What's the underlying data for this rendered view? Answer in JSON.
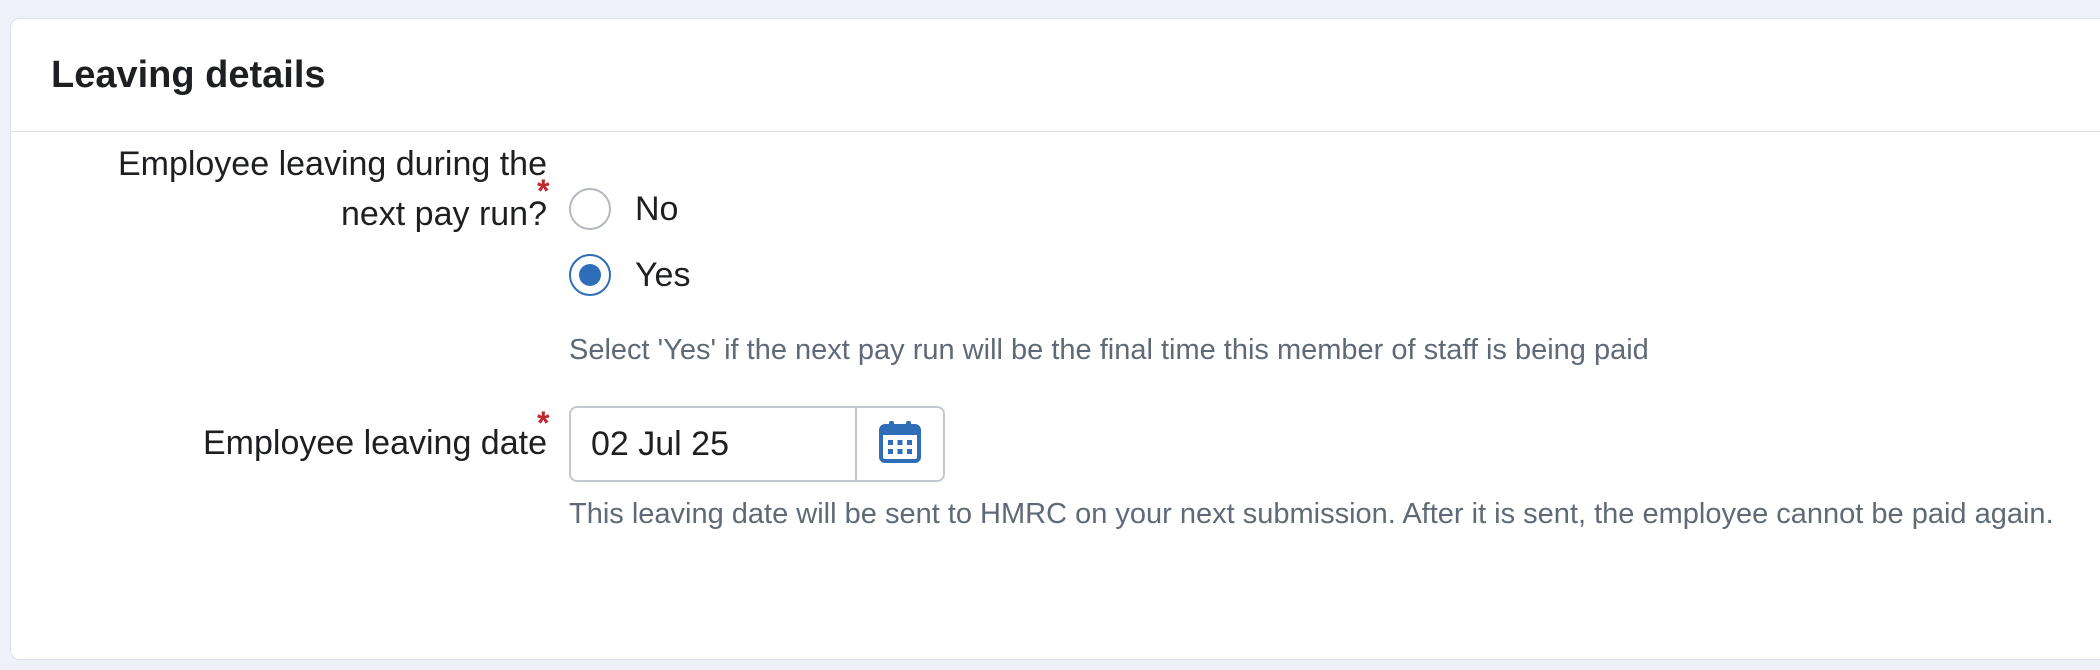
{
  "section": {
    "title": "Leaving details"
  },
  "leaving_next_run": {
    "label_line1": "Employee leaving during the",
    "label_line2": "next pay run?",
    "required_marker": "*",
    "options": [
      {
        "label": "No",
        "selected": false
      },
      {
        "label": "Yes",
        "selected": true
      }
    ],
    "hint": "Select 'Yes' if the next pay run will be the final time this member of staff is being paid"
  },
  "leaving_date": {
    "label": "Employee leaving date",
    "required_marker": "*",
    "value": "02 Jul 25",
    "button_icon": "calendar-icon",
    "hint": "This leaving date will be sent to HMRC on your next submission. After it is sent, the employee cannot be paid again."
  },
  "colors": {
    "accent": "#2e6db7",
    "required": "#c0272d",
    "hint_text": "#5f6a76",
    "border": "#dde2ea"
  }
}
